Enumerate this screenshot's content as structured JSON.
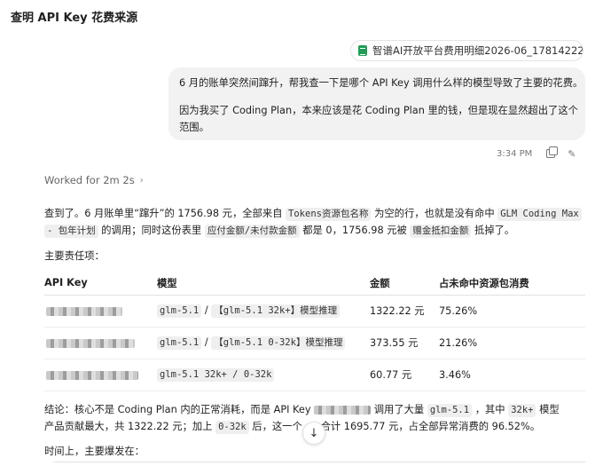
{
  "header": {
    "title": "查明 API Key 花费来源",
    "more_icon": "more-horizontal-icon"
  },
  "attachment": {
    "file_name": "智谱AI开放平台费用明细2026-06_178142224...",
    "icon": "spreadsheet-icon"
  },
  "user_message": {
    "line1": "6 月的账单突然间蹿升，帮我查一下是哪个 API Key 调用什么样的模型导致了主要的花费。",
    "line2": "因为我买了 Coding Plan，本来应该是花 Coding Plan 里的钱，但是现在显然超出了这个",
    "line3": "范围。",
    "time": "3:34 PM"
  },
  "worked": {
    "label": "Worked for 2m 2s"
  },
  "answer": {
    "p1_a": "查到了。6 月账单里“蹿升”的 1756.98 元，全部来自",
    "p1_code1": "Tokens资源包名称",
    "p1_b": "为空的行，也就是没有命中",
    "p1_code2": "GLM Coding Max",
    "p1_code3": "- 包年计划",
    "p1_c": "的调用；同时这份表里",
    "p1_code4": "应付金额/未付款金额",
    "p1_d": "都是 0，1756.98 元被",
    "p1_code5": "赠金抵扣金额",
    "p1_e": "抵掉了。",
    "section_label": "主要责任项："
  },
  "table": {
    "headers": [
      "API Key",
      "模型",
      "金额",
      "占未命中资源包消费"
    ],
    "rows": [
      {
        "model_a": "glm-5.1",
        "sep": "/",
        "model_b": "【glm-5.1 32k+】模型推理",
        "amount": "1322.22 元",
        "share": "75.26%"
      },
      {
        "model_a": "glm-5.1",
        "sep": "/",
        "model_b": "【glm-5.1 0-32k】模型推理",
        "amount": "373.55 元",
        "share": "21.26%"
      },
      {
        "model_a": "glm-5.1 32k+ / 0-32k",
        "sep": "",
        "model_b": "",
        "amount": "60.77 元",
        "share": "3.46%"
      }
    ]
  },
  "conclusion": {
    "a": "结论：核心不是 Coding Plan 内的正常消耗，而是 API Key",
    "b": "调用了大量",
    "code1": "glm-5.1",
    "c": "，其中",
    "code2": "32k+",
    "d": "模型",
    "e": "产品贡献最大，共 1322.22 元；加上",
    "code3": "0-32k",
    "f": "后，这一个",
    "g": "ey 合计 1695.77 元，占全部异常消费的 96.52%。"
  },
  "burst": {
    "label": "时间上，主要爆发在："
  },
  "colors": {
    "bubble_bg": "#f2f2f2",
    "code_bg": "#efefef",
    "text": "#1f1f1f",
    "muted": "#777777",
    "sheet_green": "#1f9d55"
  }
}
